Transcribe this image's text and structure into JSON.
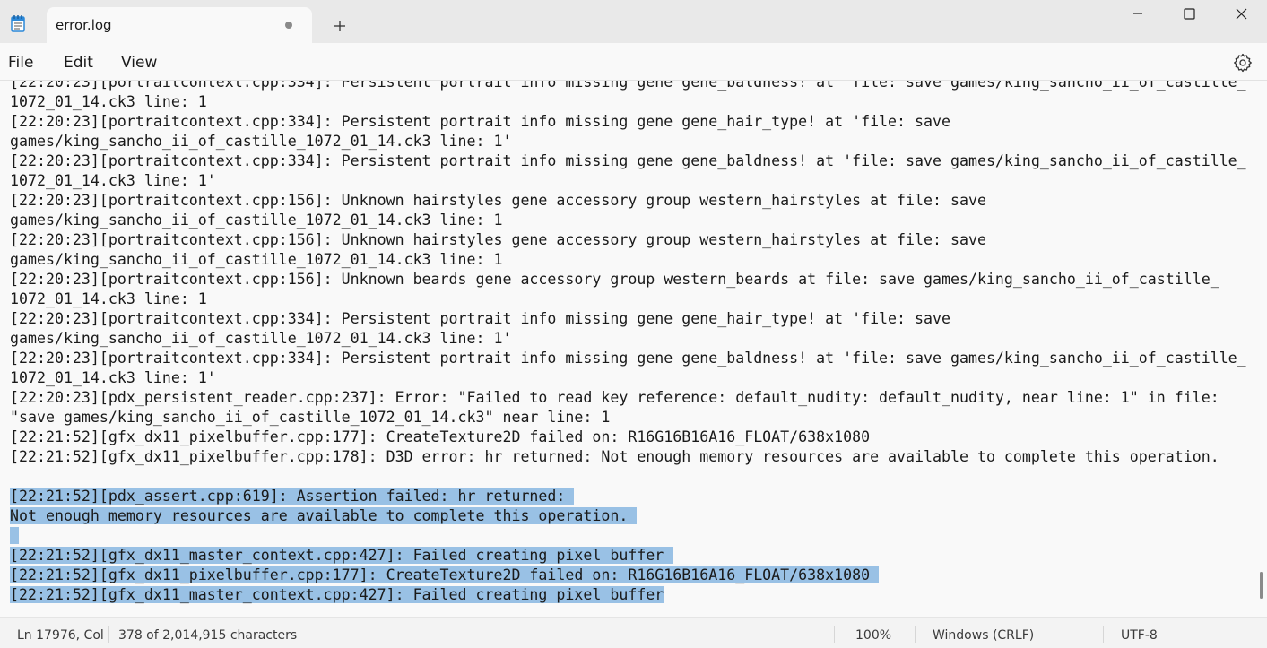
{
  "tab": {
    "title": "error.log"
  },
  "menu": {
    "file": "File",
    "edit": "Edit",
    "view": "View"
  },
  "lines": [
    {
      "parts": [
        {
          "t": "[22:20:23][portraitcontext.cpp:334]: Persistent portrait info missing gene gene_baldness! at 'file: save games/king_sancho_ii_of_castille_",
          "sel": false
        }
      ]
    },
    {
      "parts": [
        {
          "t": "1072_01_14.ck3 line: 1",
          "sel": false
        }
      ]
    },
    {
      "parts": [
        {
          "t": "[22:20:23][portraitcontext.cpp:334]: Persistent portrait info missing gene gene_hair_type! at 'file: save",
          "sel": false
        }
      ]
    },
    {
      "parts": [
        {
          "t": "games/king_sancho_ii_of_castille_1072_01_14.ck3 line: 1'",
          "sel": false
        }
      ]
    },
    {
      "parts": [
        {
          "t": "[22:20:23][portraitcontext.cpp:334]: Persistent portrait info missing gene gene_baldness! at 'file: save games/king_sancho_ii_of_castille_",
          "sel": false
        }
      ]
    },
    {
      "parts": [
        {
          "t": "1072_01_14.ck3 line: 1'",
          "sel": false
        }
      ]
    },
    {
      "parts": [
        {
          "t": "[22:20:23][portraitcontext.cpp:156]: Unknown hairstyles gene accessory group western_hairstyles at file: save",
          "sel": false
        }
      ]
    },
    {
      "parts": [
        {
          "t": "games/king_sancho_ii_of_castille_1072_01_14.ck3 line: 1",
          "sel": false
        }
      ]
    },
    {
      "parts": [
        {
          "t": "[22:20:23][portraitcontext.cpp:156]: Unknown hairstyles gene accessory group western_hairstyles at file: save",
          "sel": false
        }
      ]
    },
    {
      "parts": [
        {
          "t": "games/king_sancho_ii_of_castille_1072_01_14.ck3 line: 1",
          "sel": false
        }
      ]
    },
    {
      "parts": [
        {
          "t": "[22:20:23][portraitcontext.cpp:156]: Unknown beards gene accessory group western_beards at file: save games/king_sancho_ii_of_castille_",
          "sel": false
        }
      ]
    },
    {
      "parts": [
        {
          "t": "1072_01_14.ck3 line: 1",
          "sel": false
        }
      ]
    },
    {
      "parts": [
        {
          "t": "[22:20:23][portraitcontext.cpp:334]: Persistent portrait info missing gene gene_hair_type! at 'file: save",
          "sel": false
        }
      ]
    },
    {
      "parts": [
        {
          "t": "games/king_sancho_ii_of_castille_1072_01_14.ck3 line: 1'",
          "sel": false
        }
      ]
    },
    {
      "parts": [
        {
          "t": "[22:20:23][portraitcontext.cpp:334]: Persistent portrait info missing gene gene_baldness! at 'file: save games/king_sancho_ii_of_castille_",
          "sel": false
        }
      ]
    },
    {
      "parts": [
        {
          "t": "1072_01_14.ck3 line: 1'",
          "sel": false
        }
      ]
    },
    {
      "parts": [
        {
          "t": "[22:20:23][pdx_persistent_reader.cpp:237]: Error: \"Failed to read key reference: default_nudity: default_nudity, near line: 1\" in file:",
          "sel": false
        }
      ]
    },
    {
      "parts": [
        {
          "t": "\"save games/king_sancho_ii_of_castille_1072_01_14.ck3\" near line: 1",
          "sel": false
        }
      ]
    },
    {
      "parts": [
        {
          "t": "[22:21:52][gfx_dx11_pixelbuffer.cpp:177]: CreateTexture2D failed on: R16G16B16A16_FLOAT/638x1080",
          "sel": false
        }
      ]
    },
    {
      "parts": [
        {
          "t": "[22:21:52][gfx_dx11_pixelbuffer.cpp:178]: D3D error: hr returned: Not enough memory resources are available to complete this operation.",
          "sel": false
        }
      ]
    },
    {
      "parts": [
        {
          "t": "",
          "sel": false
        }
      ]
    },
    {
      "parts": [
        {
          "t": "[22:21:52][pdx_assert.cpp:619]: Assertion failed: hr returned: ",
          "sel": true
        }
      ]
    },
    {
      "parts": [
        {
          "t": "Not enough memory resources are available to complete this operation. ",
          "sel": true
        }
      ]
    },
    {
      "parts": [
        {
          "t": " ",
          "sel": true
        }
      ]
    },
    {
      "parts": [
        {
          "t": "[22:21:52][gfx_dx11_master_context.cpp:427]: Failed creating pixel buffer ",
          "sel": true
        }
      ]
    },
    {
      "parts": [
        {
          "t": "[22:21:52][gfx_dx11_pixelbuffer.cpp:177]: CreateTexture2D failed on: R16G16B16A16_FLOAT/638x1080 ",
          "sel": true
        }
      ]
    },
    {
      "parts": [
        {
          "t": "[22:21:52][gfx_dx11_master_context.cpp:427]: Failed creating pixel buffer",
          "sel": true
        }
      ]
    }
  ],
  "status": {
    "position": "Ln 17976, Col",
    "characters": "378 of 2,014,915 characters",
    "zoom": "100%",
    "line_ending": "Windows (CRLF)",
    "encoding": "UTF-8"
  },
  "icons": {
    "app": "notepad-icon",
    "unsaved": "unsaved-dot-icon",
    "new_tab": "plus-icon",
    "minimize": "minimize-icon",
    "maximize": "maximize-icon",
    "close": "close-icon",
    "settings": "gear-icon"
  },
  "colors": {
    "selection": "#99c1e5",
    "titlebar": "#e9e9e9",
    "editor_bg": "#f9f9f9"
  }
}
